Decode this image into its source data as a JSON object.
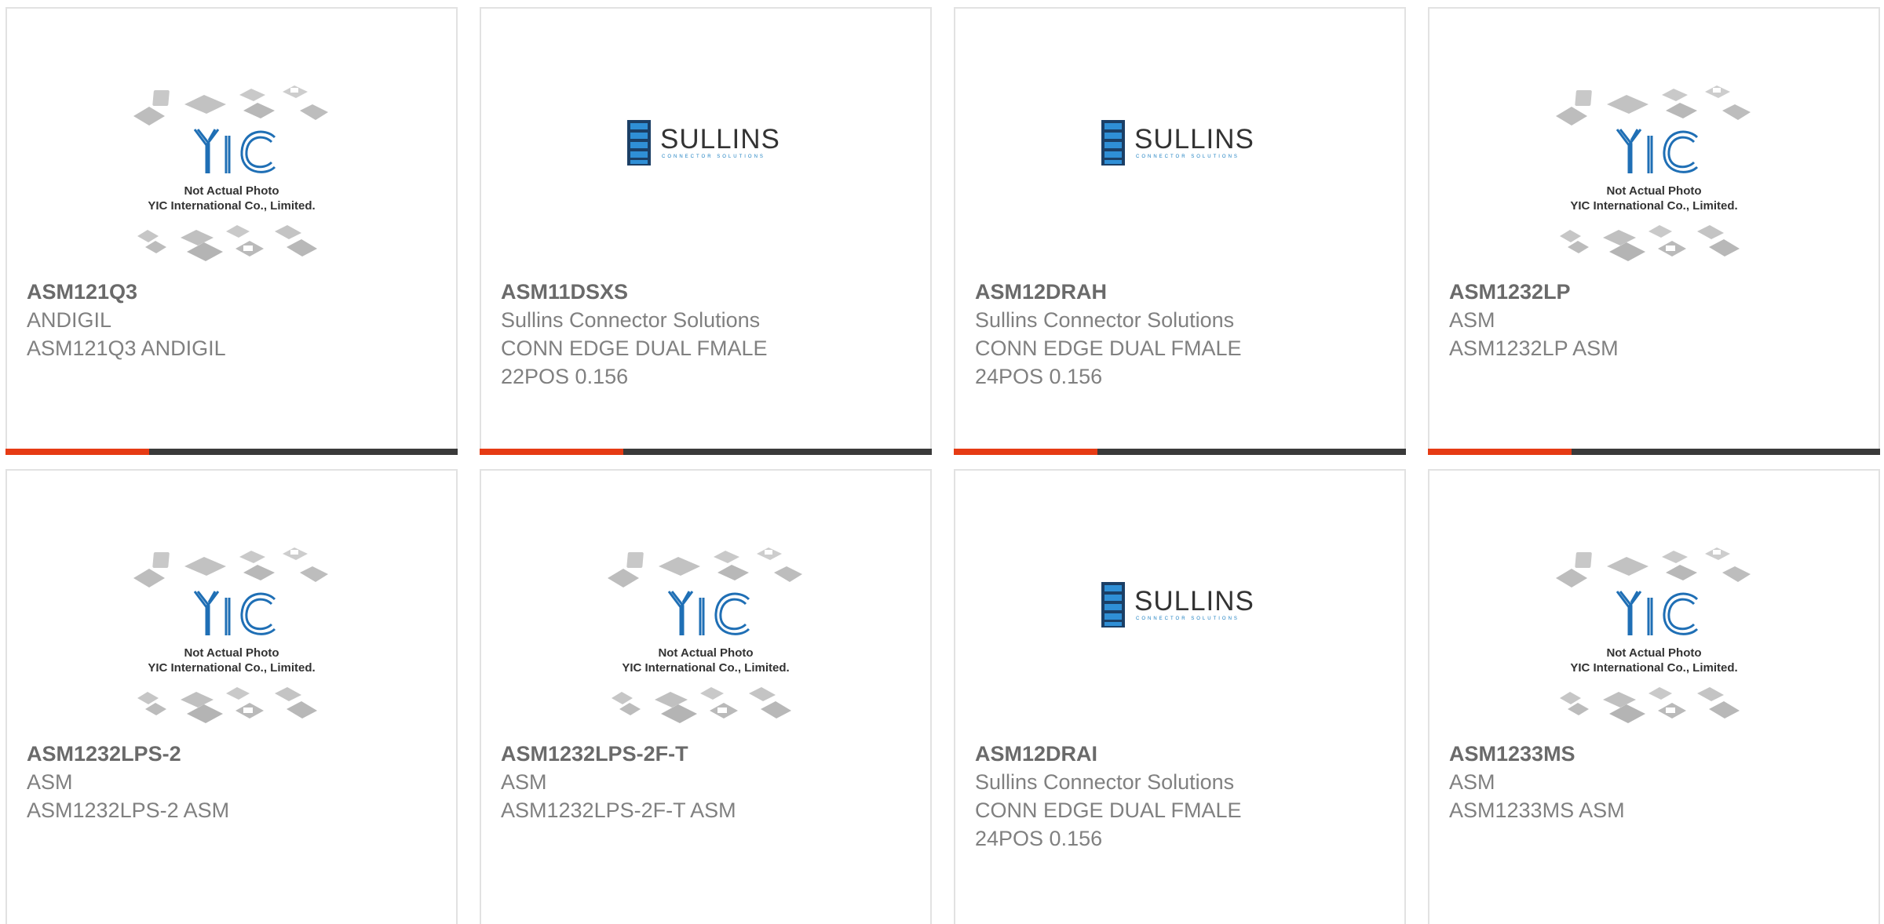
{
  "placeholder": {
    "line1": "Not Actual Photo",
    "line2": "YIC International Co., Limited.",
    "logo": "YIC"
  },
  "sullins_logo": {
    "name": "SULLINS",
    "tagline": "CONNECTOR SOLUTIONS"
  },
  "colors": {
    "accent": "#e63b14",
    "bar": "#3a3a3a",
    "yic_blue": "#1f6fb5",
    "sullins_blue": "#1b7fc1"
  },
  "products": [
    {
      "part": "ASM121Q3",
      "brand": "ANDIGIL",
      "desc1": "ASM121Q3 ANDIGIL",
      "desc2": "",
      "image": "yic"
    },
    {
      "part": "ASM11DSXS",
      "brand": "Sullins Connector Solutions",
      "desc1": "CONN EDGE DUAL FMALE",
      "desc2": "22POS 0.156",
      "image": "sullins"
    },
    {
      "part": "ASM12DRAH",
      "brand": "Sullins Connector Solutions",
      "desc1": "CONN EDGE DUAL FMALE",
      "desc2": "24POS 0.156",
      "image": "sullins"
    },
    {
      "part": "ASM1232LP",
      "brand": "ASM",
      "desc1": "ASM1232LP ASM",
      "desc2": "",
      "image": "yic"
    },
    {
      "part": "ASM1232LPS-2",
      "brand": "ASM",
      "desc1": "ASM1232LPS-2 ASM",
      "desc2": "",
      "image": "yic"
    },
    {
      "part": "ASM1232LPS-2F-T",
      "brand": "ASM",
      "desc1": "ASM1232LPS-2F-T ASM",
      "desc2": "",
      "image": "yic"
    },
    {
      "part": "ASM12DRAI",
      "brand": "Sullins Connector Solutions",
      "desc1": "CONN EDGE DUAL FMALE",
      "desc2": "24POS 0.156",
      "image": "sullins"
    },
    {
      "part": "ASM1233MS",
      "brand": "ASM",
      "desc1": "ASM1233MS ASM",
      "desc2": "",
      "image": "yic"
    }
  ]
}
